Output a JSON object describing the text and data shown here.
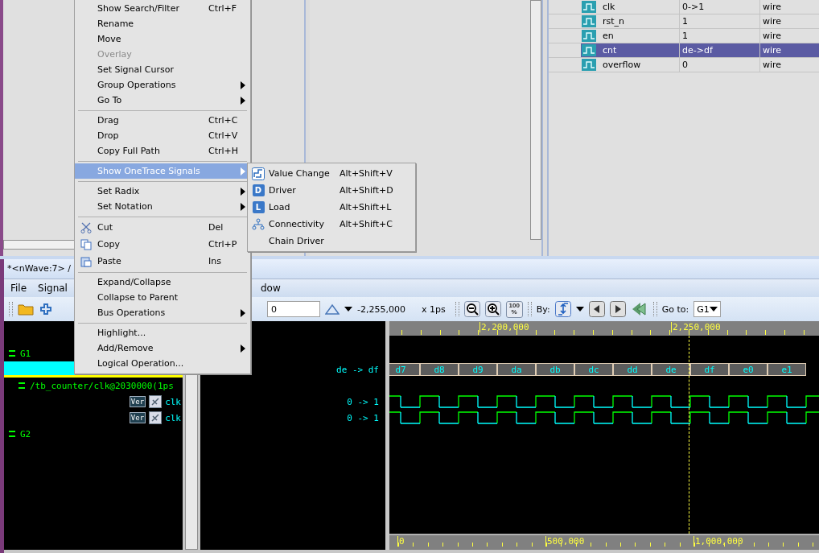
{
  "signal_table": {
    "rows": [
      {
        "name": "clk",
        "value": "0->1",
        "type": "wire",
        "selected": false
      },
      {
        "name": "rst_n",
        "value": "1",
        "type": "wire",
        "selected": false
      },
      {
        "name": "en",
        "value": "1",
        "type": "wire",
        "selected": false
      },
      {
        "name": "cnt",
        "value": "de->df",
        "type": "wire",
        "selected": true
      },
      {
        "name": "overflow",
        "value": "0",
        "type": "wire",
        "selected": false
      }
    ]
  },
  "wave_window": {
    "title": "*<nWave:7> /",
    "menu": [
      "File",
      "Signal",
      "dow"
    ],
    "toolbar": {
      "time_field": "0",
      "cursor_time": "-2,255,000",
      "scale": "x 1ps",
      "full_zoom_label": [
        "100",
        "%"
      ],
      "by_label": "By:",
      "goto_label": "Go to:",
      "goto_value": "G1"
    },
    "signals": [
      {
        "kind": "group",
        "label": "G1",
        "children": [
          {
            "kind": "bus",
            "selected": true,
            "value": "de -> df",
            "segments": [
              "d7",
              "d8",
              "d9",
              "da",
              "db",
              "dc",
              "dd",
              "de",
              "df",
              "e0",
              "e1"
            ]
          },
          {
            "kind": "path",
            "label": "/tb_counter/clk@2030000(1ps",
            "children": [
              {
                "kind": "signal",
                "badge": "Ver",
                "label": "clk",
                "value": "0 -> 1"
              },
              {
                "kind": "signal",
                "badge": "Ver",
                "label": "clk",
                "value": "0 -> 1"
              }
            ]
          }
        ]
      },
      {
        "kind": "group",
        "label": "G2"
      }
    ],
    "top_ruler": [
      "2,200,000",
      "2,250,000"
    ],
    "bottom_ruler": [
      "0",
      "500,000",
      "1,000,000"
    ]
  },
  "context_menu": {
    "items": [
      {
        "kind": "item",
        "label": "Show Search/Filter",
        "shortcut": "Ctrl+F",
        "disabled": false,
        "has_submenu": false,
        "selected": false
      },
      {
        "kind": "item",
        "label": "Rename",
        "disabled": false,
        "has_submenu": false,
        "selected": false
      },
      {
        "kind": "item",
        "label": "Move",
        "disabled": false,
        "has_submenu": false,
        "selected": false
      },
      {
        "kind": "item",
        "label": "Overlay",
        "disabled": true,
        "has_submenu": false,
        "selected": false
      },
      {
        "kind": "item",
        "label": "Set Signal Cursor",
        "disabled": false,
        "has_submenu": false,
        "selected": false
      },
      {
        "kind": "item",
        "label": "Group Operations",
        "disabled": false,
        "has_submenu": true,
        "selected": false
      },
      {
        "kind": "item",
        "label": "Go To",
        "disabled": false,
        "has_submenu": true,
        "selected": false
      },
      {
        "kind": "separator"
      },
      {
        "kind": "item",
        "label": "Drag",
        "shortcut": "Ctrl+C",
        "disabled": false,
        "has_submenu": false,
        "selected": false
      },
      {
        "kind": "item",
        "label": "Drop",
        "shortcut": "Ctrl+V",
        "disabled": false,
        "has_submenu": false,
        "selected": false
      },
      {
        "kind": "item",
        "label": "Copy Full Path",
        "shortcut": "Ctrl+H",
        "disabled": false,
        "has_submenu": false,
        "selected": false
      },
      {
        "kind": "separator"
      },
      {
        "kind": "item",
        "label": "Show OneTrace Signals",
        "disabled": false,
        "has_submenu": true,
        "selected": true
      },
      {
        "kind": "separator"
      },
      {
        "kind": "item",
        "label": "Set Radix",
        "disabled": false,
        "has_submenu": true,
        "selected": false
      },
      {
        "kind": "item",
        "label": "Set Notation",
        "disabled": false,
        "has_submenu": true,
        "selected": false
      },
      {
        "kind": "separator"
      },
      {
        "kind": "icon-item",
        "label": "Cut",
        "shortcut": "Del",
        "disabled": false,
        "has_submenu": false,
        "selected": false
      },
      {
        "kind": "icon-item",
        "label": "Copy",
        "shortcut": "Ctrl+P",
        "disabled": false,
        "has_submenu": false,
        "selected": false
      },
      {
        "kind": "icon-item",
        "label": "Paste",
        "shortcut": "Ins",
        "disabled": false,
        "has_submenu": false,
        "selected": false
      },
      {
        "kind": "separator"
      },
      {
        "kind": "item",
        "label": "Expand/Collapse",
        "disabled": false,
        "has_submenu": false,
        "selected": false
      },
      {
        "kind": "item",
        "label": "Collapse to Parent",
        "disabled": false,
        "has_submenu": false,
        "selected": false
      },
      {
        "kind": "item",
        "label": "Bus Operations",
        "disabled": false,
        "has_submenu": true,
        "selected": false
      },
      {
        "kind": "separator"
      },
      {
        "kind": "item",
        "label": "Highlight...",
        "disabled": false,
        "has_submenu": false,
        "selected": false
      },
      {
        "kind": "item",
        "label": "Add/Remove",
        "disabled": false,
        "has_submenu": true,
        "selected": false
      },
      {
        "kind": "item",
        "label": "Logical Operation...",
        "disabled": false,
        "has_submenu": false,
        "selected": false
      }
    ]
  },
  "onetrace_submenu": {
    "items": [
      {
        "label": "Value Change",
        "shortcut": "Alt+Shift+V",
        "icon": {
          "kind": "wave"
        }
      },
      {
        "label": "Driver",
        "shortcut": "Alt+Shift+D",
        "icon": {
          "kind": "letter",
          "letter": "D"
        }
      },
      {
        "label": "Load",
        "shortcut": "Alt+Shift+L",
        "icon": {
          "kind": "letter",
          "letter": "L"
        }
      },
      {
        "label": "Connectivity",
        "shortcut": "Alt+Shift+C",
        "icon": {
          "kind": "tree"
        }
      },
      {
        "label": "Chain Driver"
      }
    ]
  }
}
